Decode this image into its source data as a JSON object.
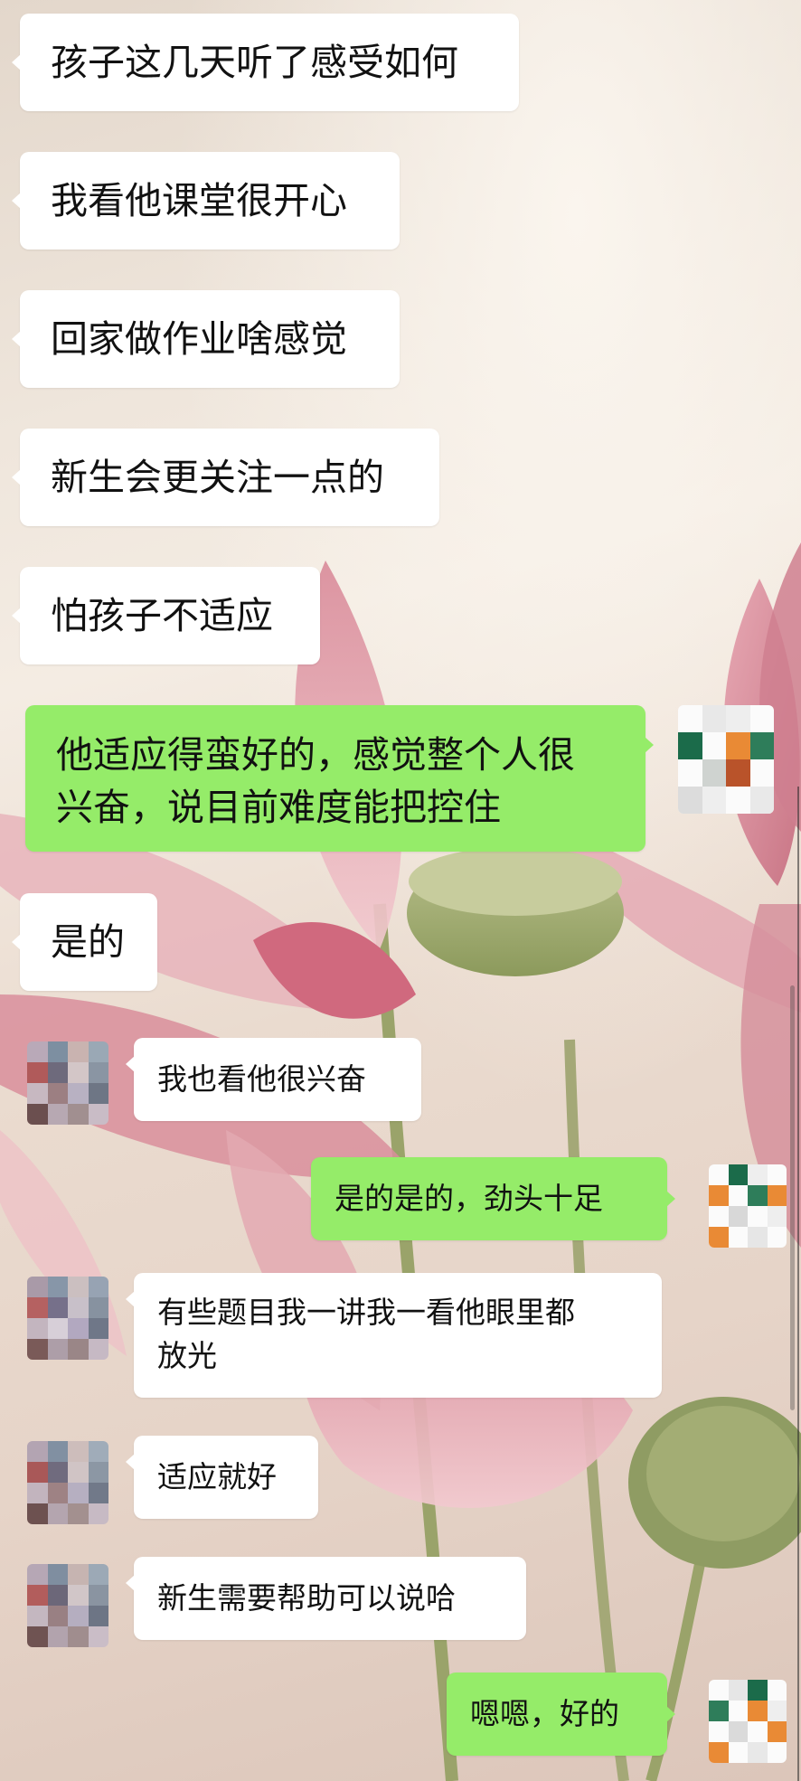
{
  "colors": {
    "incoming_bubble": "#ffffff",
    "outgoing_bubble": "#95ec69",
    "text": "#111111"
  },
  "messages": [
    {
      "id": "m1",
      "side": "incoming",
      "text": "孩子这几天听了感受如何"
    },
    {
      "id": "m2",
      "side": "incoming",
      "text": "我看他课堂很开心"
    },
    {
      "id": "m3",
      "side": "incoming",
      "text": "回家做作业啥感觉"
    },
    {
      "id": "m4",
      "side": "incoming",
      "text": "新生会更关注一点的"
    },
    {
      "id": "m5",
      "side": "incoming",
      "text": "怕孩子不适应"
    },
    {
      "id": "m6",
      "side": "outgoing",
      "text": "他适应得蛮好的，感觉整个人很\n兴奋，说目前难度能把控住"
    },
    {
      "id": "m7",
      "side": "incoming",
      "text": "是的"
    },
    {
      "id": "m8",
      "side": "incoming",
      "text": "我也看他很兴奋"
    },
    {
      "id": "m9",
      "side": "outgoing",
      "text": "是的是的，劲头十足"
    },
    {
      "id": "m10",
      "side": "incoming",
      "text": "有些题目我一讲我一看他眼里都\n放光"
    },
    {
      "id": "m11",
      "side": "incoming",
      "text": "适应就好"
    },
    {
      "id": "m12",
      "side": "incoming",
      "text": "新生需要帮助可以说哈"
    },
    {
      "id": "m13",
      "side": "outgoing",
      "text": "嗯嗯，好的"
    }
  ],
  "avatars": {
    "contact": "pixelated-contact-avatar",
    "self": "pixelated-self-avatar"
  }
}
